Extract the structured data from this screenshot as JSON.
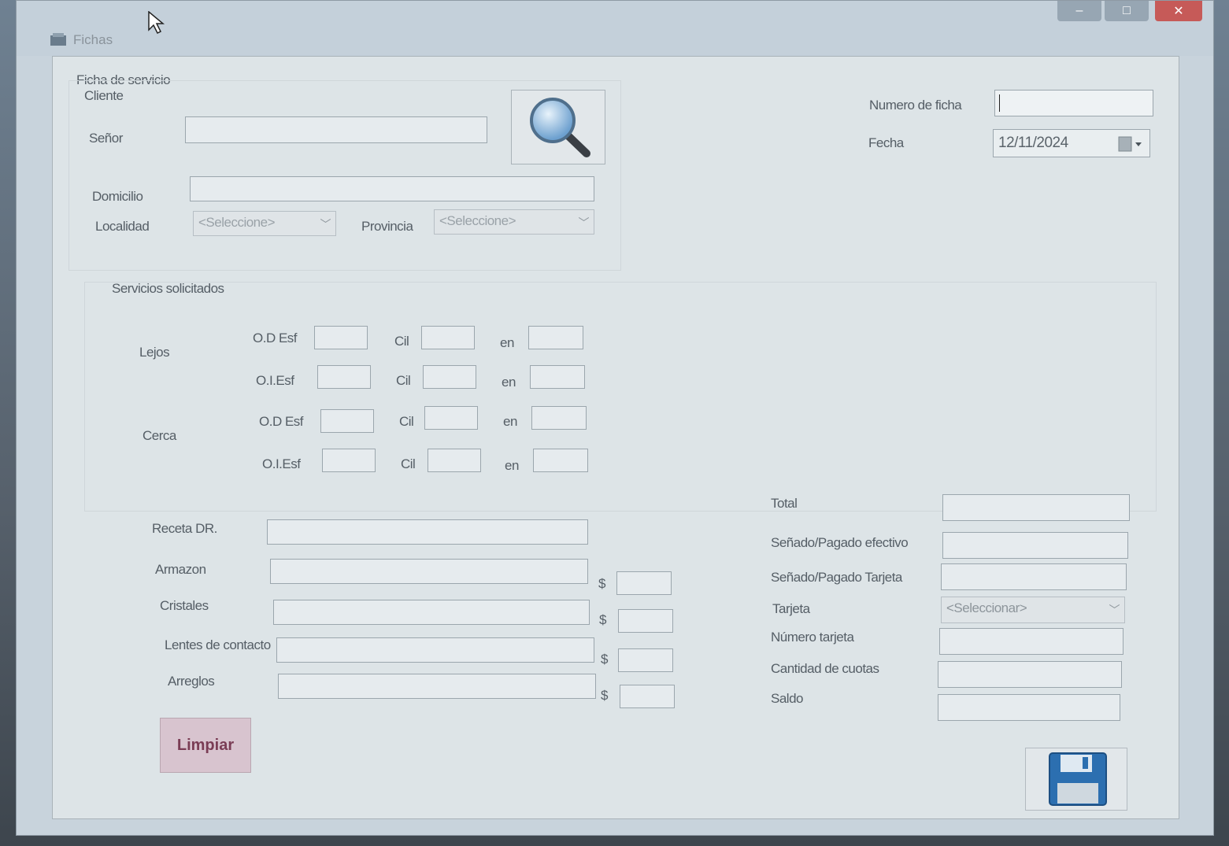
{
  "window": {
    "title": "Fichas",
    "controls": {
      "minimize": "–",
      "maximize": "□",
      "close": "✕"
    }
  },
  "header": {
    "group_title": "Ficha de servicio",
    "client_title": "Cliente"
  },
  "client": {
    "senor_label": "Señor",
    "domicilio_label": "Domicilio",
    "localidad_label": "Localidad",
    "localidad_value": "<Seleccione>",
    "provincia_label": "Provincia",
    "provincia_value": "<Seleccione>",
    "search_icon": "magnifier-icon"
  },
  "ficha": {
    "numero_label": "Numero de ficha",
    "fecha_label": "Fecha",
    "fecha_value": "12/11/2024"
  },
  "servicios": {
    "title": "Servicios solicitados",
    "lejos_label": "Lejos",
    "cerca_label": "Cerca",
    "od_label": "O.D Esf",
    "oi_label": "O.I.Esf",
    "cil_label": "Cil",
    "en_label": "en"
  },
  "items": {
    "receta_label": "Receta DR.",
    "armazon_label": "Armazon",
    "cristales_label": "Cristales",
    "lentes_label": "Lentes de contacto",
    "arreglos_label": "Arreglos",
    "currency": "$"
  },
  "payment": {
    "total_label": "Total",
    "efectivo_label": "Señado/Pagado efectivo",
    "tarjeta_pagado_label": "Señado/Pagado Tarjeta",
    "tarjeta_label": "Tarjeta",
    "tarjeta_value": "<Seleccionar>",
    "numero_tarjeta_label": "Número tarjeta",
    "cuotas_label": "Cantidad de cuotas",
    "saldo_label": "Saldo"
  },
  "actions": {
    "limpiar_label": "Limpiar",
    "save_icon": "floppy-disk-icon"
  },
  "colors": {
    "accent_limpiar": "#7a3d55",
    "close_button": "#c65a58",
    "save_icon": "#2c6fb0"
  }
}
